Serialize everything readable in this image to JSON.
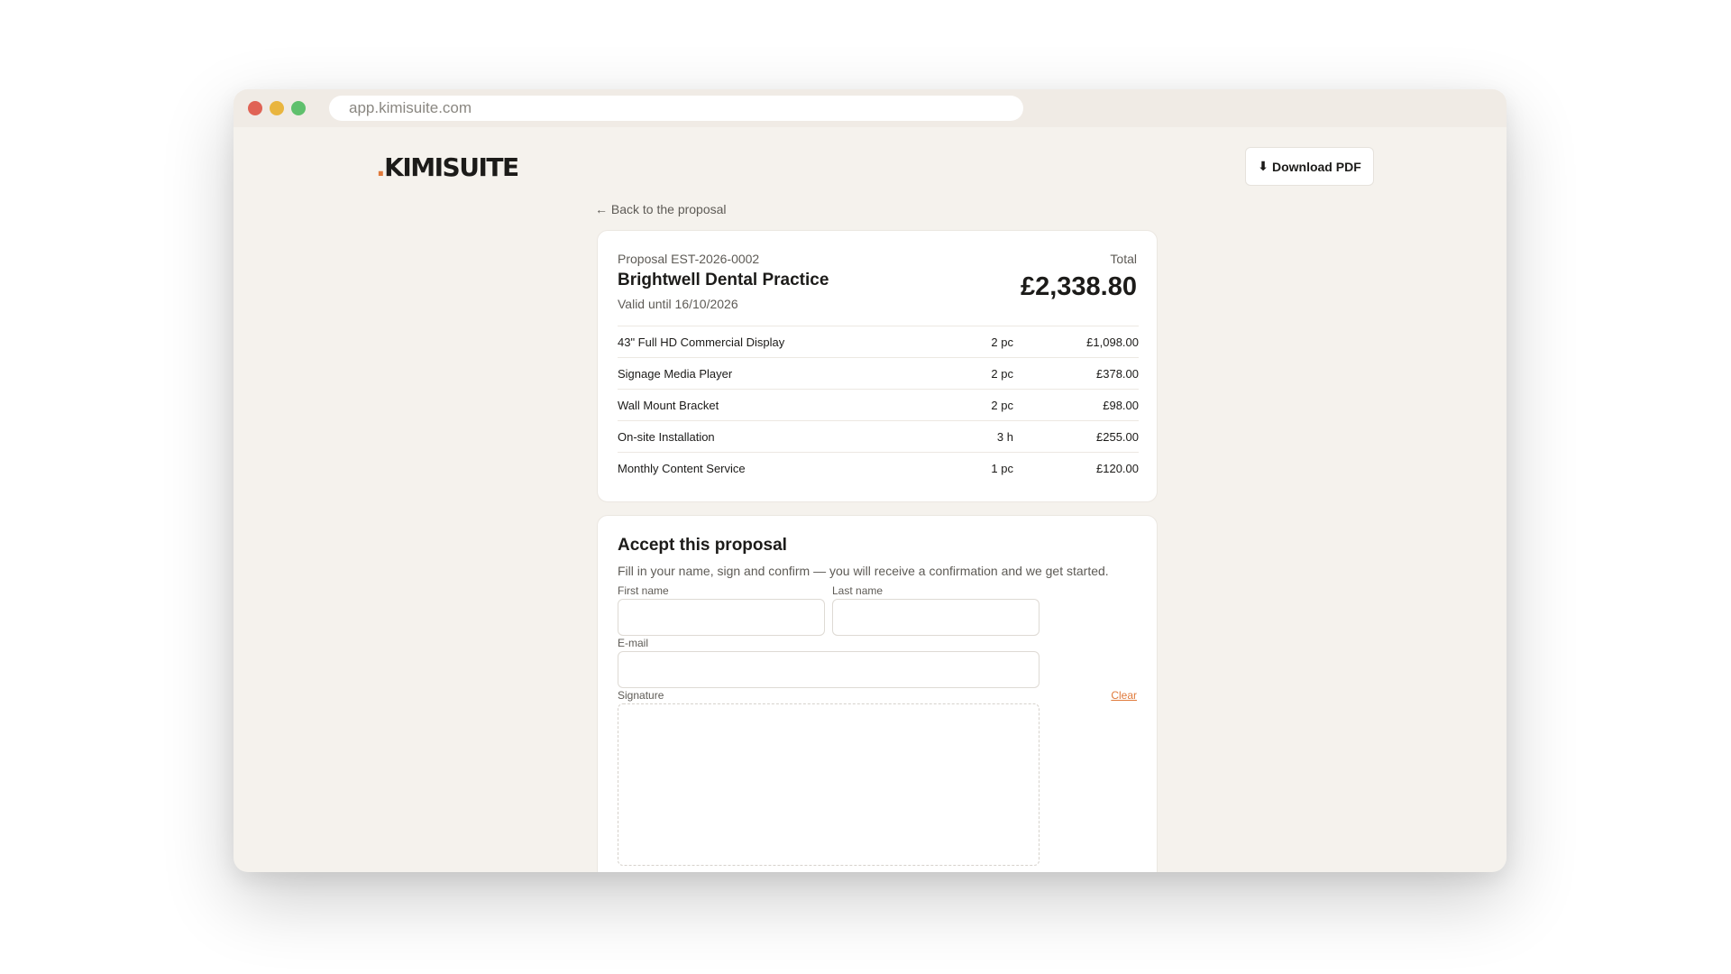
{
  "browser": {
    "url": "app.kimisuite.com"
  },
  "header": {
    "logo_dot": ".",
    "logo_text": "KIMISUITE",
    "download_icon": "download-arrow-icon",
    "download_icon_glyph": "⬇",
    "download_label": "Download PDF"
  },
  "nav": {
    "back_label": "← Back to the proposal"
  },
  "proposal": {
    "number": "Proposal EST-2026-0002",
    "client": "Brightwell Dental Practice",
    "valid_until": "Valid until 16/10/2026",
    "total_label": "Total",
    "total": "£2,338.80",
    "items": [
      {
        "name": "43\" Full HD Commercial Display",
        "qty": "2 pc",
        "price": "£1,098.00"
      },
      {
        "name": "Signage Media Player",
        "qty": "2 pc",
        "price": "£378.00"
      },
      {
        "name": "Wall Mount Bracket",
        "qty": "2 pc",
        "price": "£98.00"
      },
      {
        "name": "On-site Installation",
        "qty": "3 h",
        "price": "£255.00"
      },
      {
        "name": "Monthly Content Service",
        "qty": "1 pc",
        "price": "£120.00"
      }
    ]
  },
  "accept": {
    "title": "Accept this proposal",
    "description": "Fill in your name, sign and confirm — you will receive a confirmation and we get started.",
    "first_name_label": "First name",
    "first_name_value": "",
    "last_name_label": "Last name",
    "last_name_value": "",
    "email_label": "E-mail",
    "email_value": "",
    "signature_label": "Signature",
    "clear_label": "Clear"
  },
  "colors": {
    "accent": "#e07a3b",
    "page_background": "#f5f2ed",
    "traffic_red": "#e06355",
    "traffic_yellow": "#e9b53f",
    "traffic_green": "#5fc06d"
  }
}
